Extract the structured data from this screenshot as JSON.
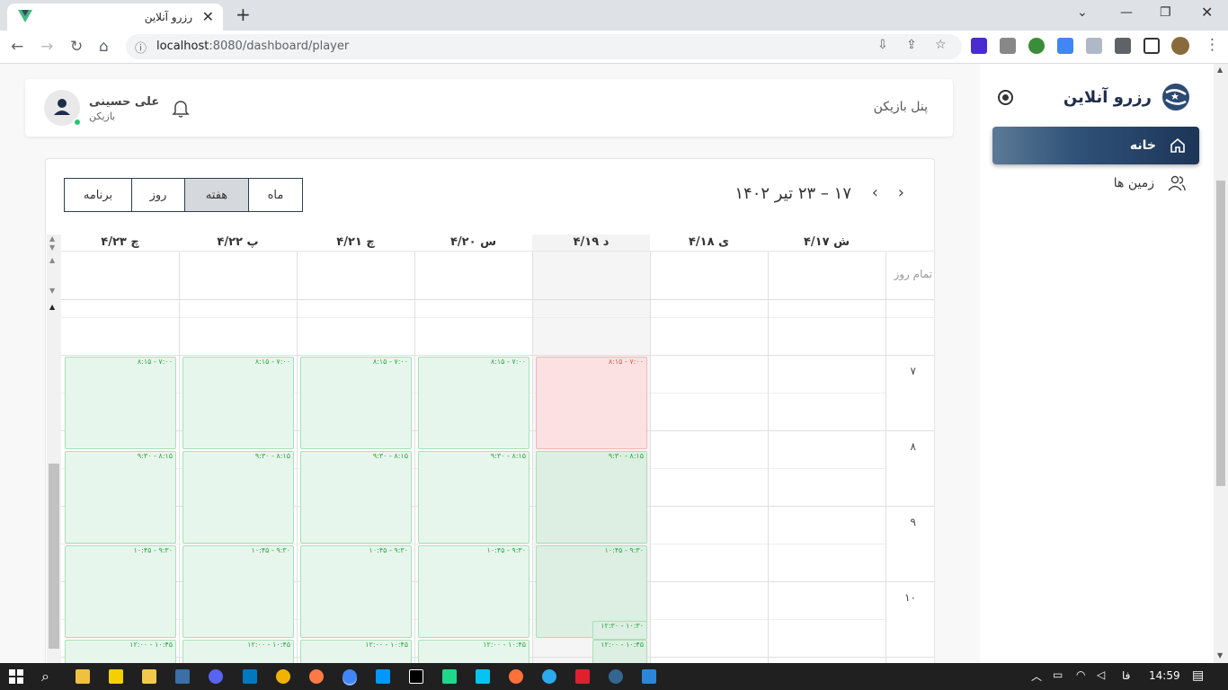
{
  "browser": {
    "tab_title": "رزرو آنلاین",
    "url_host": "localhost",
    "url_rest": ":8080/dashboard/player"
  },
  "sidebar": {
    "brand": "رزرو آنلاین",
    "items": [
      {
        "label": "خانه",
        "icon": "home-icon",
        "active": true
      },
      {
        "label": "زمین ها",
        "icon": "users-icon",
        "active": false
      }
    ]
  },
  "header": {
    "panel_title": "پنل بازیکن",
    "user_name": "علی حسینی",
    "user_role": "بازیکن"
  },
  "calendar": {
    "range_title": "۱۷ – ۲۳ تیر ۱۴۰۲",
    "views": [
      {
        "label": "ماه",
        "active": false
      },
      {
        "label": "هفته",
        "active": true
      },
      {
        "label": "روز",
        "active": false
      },
      {
        "label": "برنامه",
        "active": false
      }
    ],
    "all_day_label": "تمام روز",
    "days": [
      "ش ۴/۱۷",
      "ی ۴/۱۸",
      "د ۴/۱۹",
      "س ۴/۲۰",
      "چ ۴/۲۱",
      "پ ۴/۲۲",
      "چ ۴/۲۳"
    ],
    "hours": [
      "۷",
      "۸",
      "۹",
      "۱۰"
    ],
    "slot_labels": [
      "۸:۱۵ - ۷:۰۰",
      "۹:۳۰ - ۸:۱۵",
      "۱۰:۴۵ - ۹:۳۰",
      "۱۲:۰۰ - ۱۰:۴۵",
      "۱۲:۳۰ - ۱۰:۳۰"
    ],
    "colors": {
      "free": "#e7f6ec",
      "booked": "#fbe1e1",
      "accent": "#28a745"
    }
  },
  "taskbar": {
    "language": "فا",
    "time": "14:59"
  }
}
